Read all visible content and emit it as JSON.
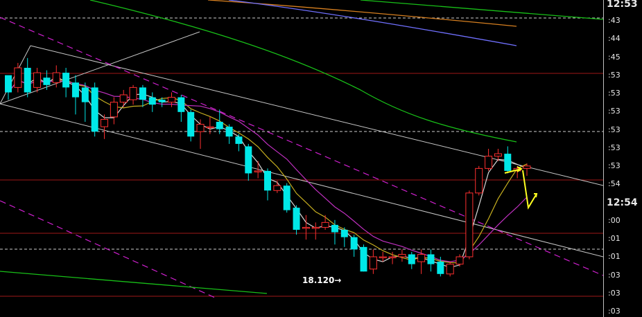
{
  "chart_data": {
    "type": "candlestick",
    "grid": true,
    "x_axis": "time",
    "y_axis": "price",
    "y_axis_side": "right",
    "tick_labels": [
      {
        "text": "12:53",
        "major": true
      },
      {
        "text": ":43",
        "major": false
      },
      {
        "text": ":44",
        "major": false
      },
      {
        "text": ":45",
        "major": false
      },
      {
        "text": ":53",
        "major": false
      },
      {
        "text": ":53",
        "major": false
      },
      {
        "text": ":53",
        "major": false
      },
      {
        "text": ":53",
        "major": false
      },
      {
        "text": ":53",
        "major": false
      },
      {
        "text": ":53",
        "major": false
      },
      {
        "text": ":54",
        "major": false
      },
      {
        "text": "12:54",
        "major": true
      },
      {
        "text": ":00",
        "major": false
      },
      {
        "text": ":01",
        "major": false
      },
      {
        "text": ":01",
        "major": false
      },
      {
        "text": ":03",
        "major": false
      },
      {
        "text": ":03",
        "major": false
      },
      {
        "text": ":03",
        "major": false
      }
    ],
    "annotation": {
      "text": "18.120→",
      "low_value": 18.12
    },
    "y_range": [
      18.09,
      18.2
    ],
    "candles": [
      [
        18.175,
        18.168,
        18.172,
        18.165
      ],
      [
        18.17,
        18.178,
        18.18,
        18.168
      ],
      [
        18.178,
        18.168,
        18.182,
        18.166
      ],
      [
        18.17,
        18.176,
        18.178,
        18.168
      ],
      [
        18.174,
        18.171,
        18.177,
        18.169
      ],
      [
        18.172,
        18.176,
        18.179,
        18.17
      ],
      [
        18.176,
        18.17,
        18.178,
        18.166
      ],
      [
        18.172,
        18.166,
        18.175,
        18.159
      ],
      [
        18.17,
        18.164,
        18.172,
        18.156
      ],
      [
        18.17,
        18.152,
        18.172,
        18.15
      ],
      [
        18.154,
        18.157,
        18.159,
        18.149
      ],
      [
        18.158,
        18.164,
        18.166,
        18.155
      ],
      [
        18.164,
        18.167,
        18.169,
        18.162
      ],
      [
        18.165,
        18.17,
        18.171,
        18.163
      ],
      [
        18.17,
        18.165,
        18.171,
        18.162
      ],
      [
        18.166,
        18.163,
        18.168,
        18.16
      ],
      [
        18.165,
        18.164,
        18.166,
        18.162
      ],
      [
        18.164,
        18.166,
        18.168,
        18.162
      ],
      [
        18.166,
        18.16,
        18.167,
        18.156
      ],
      [
        18.16,
        18.15,
        18.161,
        18.148
      ],
      [
        18.152,
        18.155,
        18.157,
        18.145
      ],
      [
        18.154,
        18.154,
        18.158,
        18.151
      ],
      [
        18.156,
        18.153,
        18.161,
        18.151
      ],
      [
        18.154,
        18.15,
        18.155,
        18.147
      ],
      [
        18.15,
        18.147,
        18.151,
        18.144
      ],
      [
        18.146,
        18.135,
        18.147,
        18.132
      ],
      [
        18.136,
        18.136,
        18.14,
        18.133
      ],
      [
        18.136,
        18.128,
        18.137,
        18.124
      ],
      [
        18.128,
        18.13,
        18.132,
        18.127
      ],
      [
        18.13,
        18.12,
        18.131,
        18.119
      ],
      [
        18.121,
        18.112,
        18.122,
        18.11
      ],
      [
        18.113,
        18.113,
        18.118,
        18.108
      ],
      [
        18.113,
        18.113,
        18.115,
        18.108
      ],
      [
        18.113,
        18.115,
        18.118,
        18.112
      ],
      [
        18.114,
        18.111,
        18.116,
        18.106
      ],
      [
        18.112,
        18.109,
        18.113,
        18.105
      ],
      [
        18.109,
        18.104,
        18.11,
        18.101
      ],
      [
        18.105,
        18.095,
        18.106,
        18.095
      ],
      [
        18.096,
        18.101,
        18.104,
        18.094
      ],
      [
        18.101,
        18.101,
        18.103,
        18.099
      ],
      [
        18.101,
        18.101,
        18.103,
        18.098
      ],
      [
        18.101,
        18.102,
        18.104,
        18.099
      ],
      [
        18.102,
        18.098,
        18.103,
        18.096
      ],
      [
        18.099,
        18.102,
        18.104,
        18.094
      ],
      [
        18.102,
        18.098,
        18.104,
        18.095
      ],
      [
        18.099,
        18.094,
        18.101,
        18.093
      ],
      [
        18.094,
        18.098,
        18.099,
        18.093
      ],
      [
        18.098,
        18.101,
        18.102,
        18.097
      ],
      [
        18.101,
        18.127,
        18.128,
        18.1
      ],
      [
        18.127,
        18.137,
        18.138,
        18.126
      ],
      [
        18.137,
        18.142,
        18.145,
        18.136
      ],
      [
        18.142,
        18.143,
        18.145,
        18.14
      ],
      [
        18.143,
        18.136,
        18.146,
        18.135
      ],
      [
        18.136,
        18.137,
        18.138,
        18.133
      ],
      [
        18.137,
        18.138,
        18.139,
        18.134
      ]
    ]
  }
}
